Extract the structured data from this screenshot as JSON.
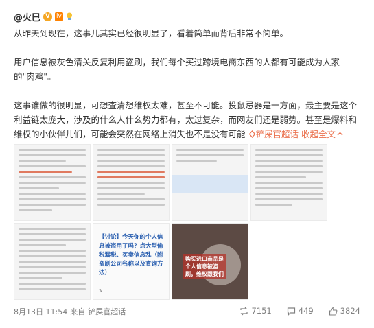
{
  "post": {
    "author": "@火巳",
    "badges": {
      "v_icon": "V",
      "level_icon": "lv"
    },
    "paragraphs": [
      "从昨天到现在，这事儿其实已经很明显了，看着简单而背后非常不简单。",
      "用户信息被灰色清关反复利用盗刷，我们每个买过跨境电商东西的人都有可能成为人家的\"肉鸡\"。"
    ],
    "paragraph3_main": "这事谁做的很明显，可想查清想维权太难，甚至不可能。投鼠忌器是一方面，最主要是这个利益链太庞大，涉及的什么人什么势力都有，太过复杂，而网友们还是弱势。甚至是爆料和维权的小伙伴儿们，可能会突然在网络上消失也不是没有可能",
    "hashtag": "铲屎官超话",
    "fold_label": "收起全文",
    "fold_icon": "chevron-up"
  },
  "images": [
    {
      "kind": "text",
      "title": ""
    },
    {
      "kind": "text",
      "title": ""
    },
    {
      "kind": "text",
      "title": ""
    },
    {
      "kind": "text",
      "title": ""
    },
    {
      "kind": "text",
      "title": ""
    },
    {
      "kind": "text",
      "title": ""
    },
    {
      "kind": "text",
      "title": ""
    },
    {
      "kind": "topic",
      "title": "【讨论】今天你的个人信息被盗用了吗？点大型偷税漏税、买卖信息乱（附盗刷公司名称以及查询方法）"
    },
    {
      "kind": "dark",
      "title": "购买进口商品是个人信息被盗刷，维权跟我们"
    }
  ],
  "footer": {
    "date": "8月13日 11:54",
    "source_prefix": "来自",
    "source": "铲屎官超话",
    "reposts": "7151",
    "comments": "449",
    "likes": "3824"
  }
}
